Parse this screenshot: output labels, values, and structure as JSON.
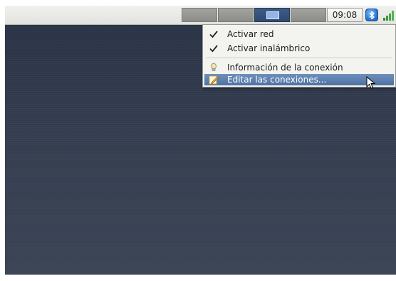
{
  "panel": {
    "clock": "09:08",
    "workspaces": [
      "",
      "",
      "",
      ""
    ],
    "active_workspace": 3,
    "tray_icons": [
      "bluetooth-icon",
      "network-signal-icon"
    ]
  },
  "menu": {
    "items": [
      {
        "label": "Activar red",
        "icon": "check-icon",
        "checked": true
      },
      {
        "label": "Activar inalámbrico",
        "icon": "check-icon",
        "checked": true
      },
      {
        "label": "Información de la conexión",
        "icon": "info-icon"
      },
      {
        "label": "Editar las conexiones...",
        "icon": "edit-icon",
        "highlighted": true
      }
    ]
  },
  "colors": {
    "desktop": "#2f3a4c",
    "menu_highlight": "#5a7bab",
    "panel": "#e9e9e5"
  }
}
